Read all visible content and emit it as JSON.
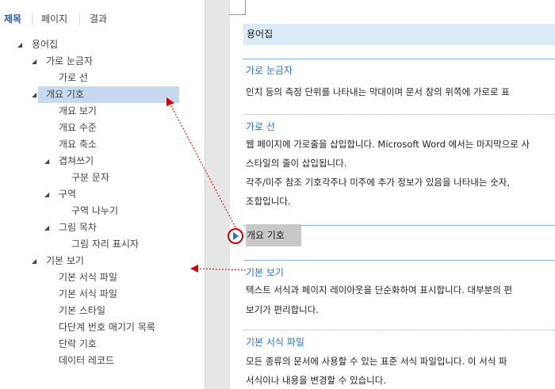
{
  "nav": {
    "tabs": [
      {
        "label": "제목",
        "active": true
      },
      {
        "label": "페이지",
        "active": false
      },
      {
        "label": "결과",
        "active": false
      }
    ],
    "tree": [
      {
        "label": "용어집",
        "level": 0,
        "expanded": true
      },
      {
        "label": "가로 눈금자",
        "level": 1,
        "expanded": true
      },
      {
        "label": "가로 선",
        "level": 2
      },
      {
        "label": "개요 기호",
        "level": 1,
        "expanded": true,
        "selected": true
      },
      {
        "label": "개요 보기",
        "level": 2
      },
      {
        "label": "개요 수준",
        "level": 2
      },
      {
        "label": "개요 축소",
        "level": 2
      },
      {
        "label": "겹쳐쓰기",
        "level": 2,
        "expanded": true
      },
      {
        "label": "구분 문자",
        "level": 3
      },
      {
        "label": "구역",
        "level": 2,
        "expanded": true
      },
      {
        "label": "구역 나누기",
        "level": 3
      },
      {
        "label": "그림 목차",
        "level": 2,
        "expanded": true
      },
      {
        "label": "그림 자리 표시자",
        "level": 3
      },
      {
        "label": "기본 보기",
        "level": 1,
        "expanded": true
      },
      {
        "label": "기본 서식 파일",
        "level": 2
      },
      {
        "label": "기본 서식 파일",
        "level": 2
      },
      {
        "label": "기본 스타일",
        "level": 2
      },
      {
        "label": "다단계 번호 매기기 목록",
        "level": 2
      },
      {
        "label": "단락 기호",
        "level": 2
      },
      {
        "label": "데이터 레코드",
        "level": 2
      }
    ]
  },
  "document": {
    "title": "용어집",
    "headings": {
      "h1": "가로 눈금자",
      "h2": "가로 선",
      "h3": "개요 기호",
      "h4": "기본 보기",
      "h5": "기본 서식 파일"
    },
    "body": {
      "p1": "인치 등의 측정 단위를 나타내는 막대이며 문서 창의 위쪽에 가로로 표",
      "p2_1": "웹 페이지에 가로줄을 삽입합니다. Microsoft Word 에서는 마지막으로 사",
      "p2_2": "스타일의 줄이 삽입됩니다.",
      "p2_3": "각주/미주 참조 기호각주나 미주에 추가 정보가 있음을 나타내는 숫자,",
      "p2_4": "조합입니다.",
      "p4_1": "텍스트 서식과 페이지 레이아웃을 단순화하여 표시합니다. 대부분의 편",
      "p4_2": "보기가 편리합니다.",
      "p5_1": "모든 종류의 문서에 사용할 수 있는 표준 서식 파일입니다. 이 서식 파",
      "p5_2": "서식이나 내용을 변경할 수 있습니다."
    }
  },
  "colors": {
    "accent": "#2e74b5",
    "selection": "#c6d9f1",
    "annotation": "#d40000"
  },
  "icons": {
    "expanded": "expanded-triangle-icon",
    "expand_button": "expand-heading-icon"
  }
}
